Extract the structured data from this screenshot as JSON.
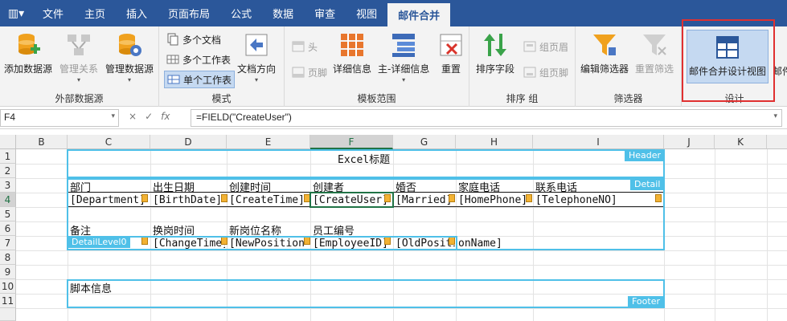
{
  "app": {
    "menu_glyph": "▥▾"
  },
  "tabs": [
    "文件",
    "主页",
    "插入",
    "页面布局",
    "公式",
    "数据",
    "审查",
    "视图",
    "邮件合并"
  ],
  "ribbon": {
    "datasource": {
      "add": "添加数据源",
      "relation": "管理关系",
      "manage": "管理数据源",
      "label": "外部数据源"
    },
    "mode": {
      "multi_doc": "多个文档",
      "multi_sheet": "多个工作表",
      "single_sheet": "单个工作表",
      "direction": "文档方向",
      "label": "模式"
    },
    "template": {
      "head": "头",
      "footer": "页脚",
      "detail": "详细信息",
      "master_detail": "主-详细信息",
      "reset": "重置",
      "label": "模板范围"
    },
    "sortgroup": {
      "sort": "排序字段",
      "group_head": "组页眉",
      "group_foot": "组页脚",
      "label": "排序  组"
    },
    "filter": {
      "edit": "编辑筛选器",
      "reset": "重置筛选",
      "label": "筛选器"
    },
    "design": {
      "view": "邮件合并设计视图",
      "label": "设计",
      "overflow": "邮件"
    }
  },
  "formula_bar": {
    "name_box": "F4",
    "cancel": "×",
    "confirm": "✓",
    "fx": "fx",
    "formula": "=FIELD(\"CreateUser\")"
  },
  "columns": [
    "B",
    "C",
    "D",
    "E",
    "F",
    "G",
    "H",
    "I",
    "J",
    "K"
  ],
  "rows": [
    "1",
    "2",
    "3",
    "4",
    "5",
    "6",
    "7",
    "8",
    "9",
    "10",
    "11"
  ],
  "sheet": {
    "title": "Excel标题",
    "headers_row3": [
      "部门",
      "出生日期",
      "创建时间",
      "创建者",
      "婚否",
      "家庭电话",
      "联系电话"
    ],
    "fields_row4": [
      "[Department]",
      "[BirthDate]",
      "[CreateTime]",
      "[CreateUser]",
      "[Married]",
      "[HomePhone]",
      "[TelephoneNO]"
    ],
    "headers_row6": [
      "备注",
      "换岗时间",
      "新岗位名称",
      "员工编号"
    ],
    "fields_row7": [
      "[ChangeTime]",
      "[NewPosition",
      "[EmployeeID]",
      "[OldPosition",
      "onName]"
    ],
    "footer_text": "脚本信息"
  },
  "regions": {
    "header": "Header",
    "detail": "Detail",
    "detail_level": "DetailLevel0",
    "footer": "Footer"
  },
  "colors": {
    "tabbar": "#2b579a",
    "region": "#4fc0e8",
    "highlight": "#e03030"
  }
}
